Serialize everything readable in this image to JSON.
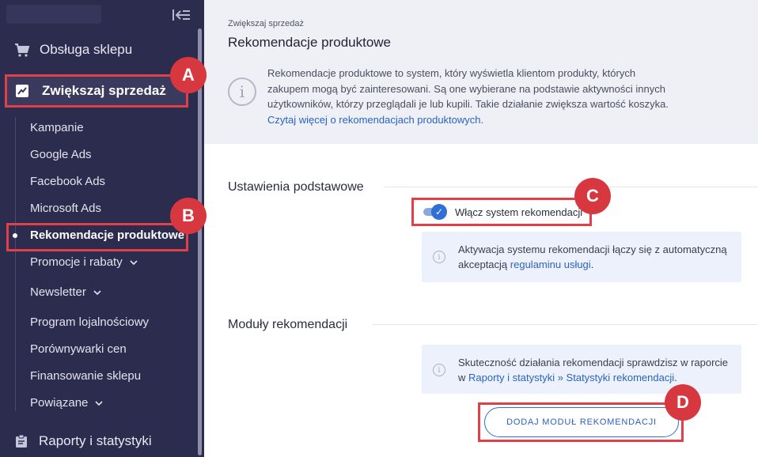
{
  "sidebar": {
    "top_item": "Obsługa sklepu",
    "active_section": "Zwiększaj sprzedaż",
    "sub_items": [
      {
        "label": "Kampanie",
        "chevron": false
      },
      {
        "label": "Google Ads",
        "chevron": false
      },
      {
        "label": "Facebook Ads",
        "chevron": false
      },
      {
        "label": "Microsoft Ads",
        "chevron": false
      },
      {
        "label": "Rekomendacje produktowe",
        "chevron": false,
        "active": true
      },
      {
        "label": "Promocje i rabaty",
        "chevron": true
      },
      {
        "label": "Newsletter",
        "chevron": true
      },
      {
        "label": "Program lojalnościowy",
        "chevron": false
      },
      {
        "label": "Porównywarki cen",
        "chevron": false
      },
      {
        "label": "Finansowanie sklepu",
        "chevron": false
      },
      {
        "label": "Powiązane",
        "chevron": true
      }
    ],
    "bottom_item": "Raporty i statystyki"
  },
  "callouts": {
    "a": "A",
    "b": "B",
    "c": "C",
    "d": "D"
  },
  "header": {
    "breadcrumb": "Zwiększaj sprzedaż",
    "title": "Rekomendacje produktowe",
    "info_text": "Rekomendacje produktowe to system, który wyświetla klientom produkty, których zakupem mogą być zainteresowani. Są one wybierane na podstawie aktywności innych użytkowników, którzy przeglądali je lub kupili. Takie działanie zwiększa wartość koszyka.",
    "info_link": "Czytaj więcej o rekomendacjach produktowych."
  },
  "basic_settings": {
    "title": "Ustawienia podstawowe",
    "toggle_label": "Włącz system rekomendacji",
    "toggle_on": true,
    "note_text": "Aktywacja systemu rekomendacji łączy się z automatyczną akceptacją",
    "note_link": "regulaminu usługi",
    "note_suffix": "."
  },
  "modules": {
    "title": "Moduły rekomendacji",
    "note_text": "Skuteczność działania rekomendacji sprawdzisz w raporcie w",
    "note_link": "Raporty i statystyki » Statystyki rekomendacji",
    "note_suffix": ".",
    "add_button": "DODAJ MODUŁ REKOMENDACJI"
  },
  "colors": {
    "sidebar_bg": "#2c2c4e",
    "accent_blue": "#2f6fd6",
    "callout_red": "#d7373e"
  }
}
